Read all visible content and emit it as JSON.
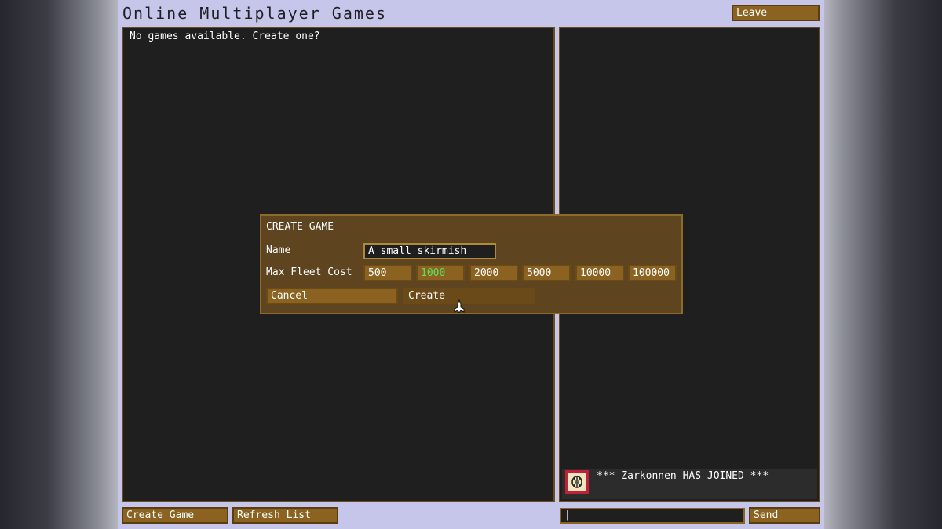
{
  "header": {
    "title": "Online Multiplayer Games",
    "leave_label": "Leave"
  },
  "games_panel": {
    "empty_message": "No games available. Create one?"
  },
  "chat": {
    "messages": [
      {
        "avatar_icon": "alien-emblem-icon",
        "text": "*** Zarkonnen HAS JOINED ***"
      }
    ],
    "input_value": "|",
    "send_label": "Send"
  },
  "footer": {
    "create_game_label": "Create Game",
    "refresh_list_label": "Refresh List"
  },
  "dialog": {
    "title": "CREATE GAME",
    "name_label": "Name",
    "name_value": "A small skirmish",
    "max_fleet_cost_label": "Max Fleet Cost",
    "cost_options": [
      "500",
      "1000",
      "2000",
      "5000",
      "10000",
      "100000"
    ],
    "selected_cost": "1000",
    "cancel_label": "Cancel",
    "create_label": "Create"
  },
  "colors": {
    "background": "#c6c6ea",
    "panel": "#1f1f1f",
    "button": "#8b6220",
    "selected_text": "#5fe05f",
    "avatar_border": "#c0203a"
  }
}
